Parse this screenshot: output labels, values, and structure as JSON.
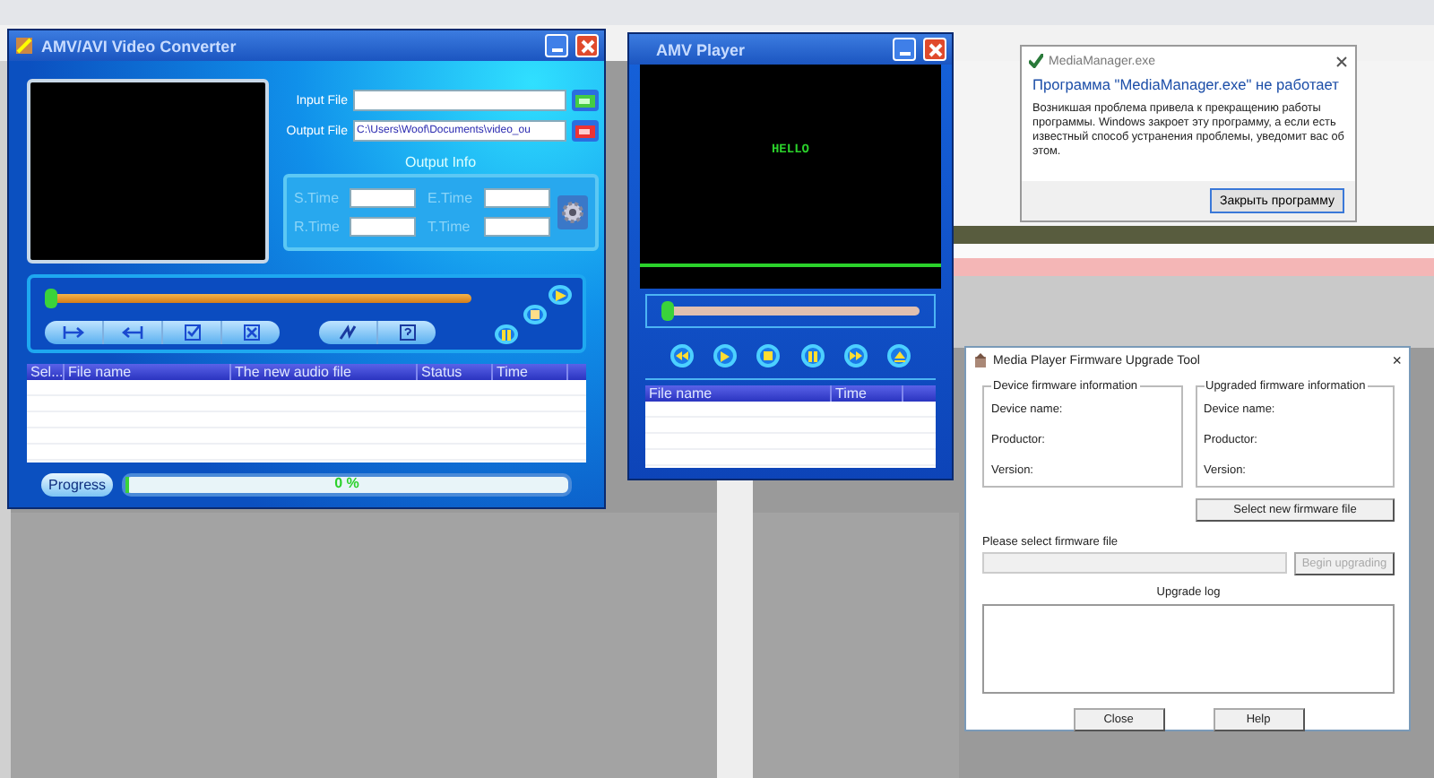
{
  "converter": {
    "title": "AMV/AVI Video Converter",
    "input_label": "Input File",
    "output_label": "Output File",
    "output_value": "C:\\Users\\Woof\\Documents\\video_ou",
    "output_info_title": "Output Info",
    "time_fields": [
      "S.Time",
      "E.Time",
      "R.Time",
      "T.Time"
    ],
    "seek": {
      "level": 0
    },
    "columns": [
      "Sel...",
      "File name",
      "The new audio file",
      "Status",
      "Time"
    ],
    "progress_button": "Progress",
    "progress": {
      "level": 0,
      "reading": "0 %"
    }
  },
  "player": {
    "title": "AMV Player",
    "screen_text": "HELLO",
    "seek": {
      "level": 0
    },
    "columns": [
      "File name",
      "Time"
    ]
  },
  "error_dialog": {
    "title": "MediaManager.exe",
    "heading": "Программа \"MediaManager.exe\" не работает",
    "message": "Возникшая проблема привела к прекращению работы программы. Windows закроет эту программу, а если есть известный способ устранения проблемы, уведомит вас об этом.",
    "button": "Закрыть программу"
  },
  "firmware_tool": {
    "title": "Media Player Firmware Upgrade Tool",
    "close_glyph": "×",
    "groups": [
      {
        "title": "Device firmware information",
        "fields": [
          "Device name:",
          "Productor:",
          "Version:"
        ]
      },
      {
        "title": "Upgraded firmware information",
        "fields": [
          "Device name:",
          "Productor:",
          "Version:"
        ]
      }
    ],
    "select_button": "Select new firmware file",
    "file_label": "Please select firmware file",
    "begin_button": {
      "label": "Begin upgrading",
      "disabled": true
    },
    "log_label": "Upgrade log",
    "buttons": [
      "Close",
      "Help"
    ]
  }
}
